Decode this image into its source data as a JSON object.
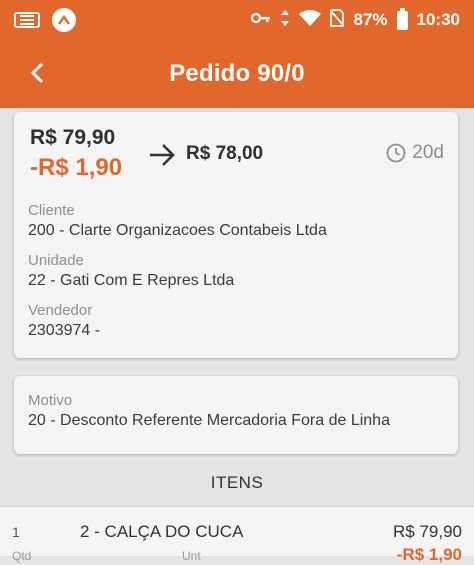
{
  "status_bar": {
    "battery": "87%",
    "time": "10:30",
    "app_badge": "^"
  },
  "header": {
    "title": "Pedido 90/0"
  },
  "summary": {
    "original_price": "R$ 79,90",
    "discount": "-R$ 1,90",
    "final_price": "R$ 78,00",
    "days": "20d",
    "cliente_label": "Cliente",
    "cliente_value": "200 - Clarte Organizacoes Contabeis Ltda",
    "unidade_label": "Unidade",
    "unidade_value": "22 - Gati Com E Repres Ltda",
    "vendedor_label": "Vendedor",
    "vendedor_value": "2303974 -"
  },
  "motivo": {
    "label": "Motivo",
    "value": "20 - Desconto Referente Mercadoria Fora de Linha"
  },
  "itens": {
    "title": "ITENS",
    "rows": [
      {
        "seq": "1",
        "description": "2 - CALÇA DO CUCA",
        "price": "R$ 79,90",
        "discount": "-R$ 1,90",
        "qtd_label": "Qtd",
        "unt_label": "Unt"
      }
    ]
  },
  "colors": {
    "accent": "#e2672c",
    "background": "#e6e4e3",
    "card": "#f4f4f4"
  },
  "icons": [
    "keyboard-icon",
    "app-notification-icon",
    "key-icon",
    "data-arrows-icon",
    "wifi-icon",
    "no-sim-icon",
    "battery-icon",
    "back-arrow-icon",
    "right-arrow-icon",
    "clock-icon"
  ]
}
